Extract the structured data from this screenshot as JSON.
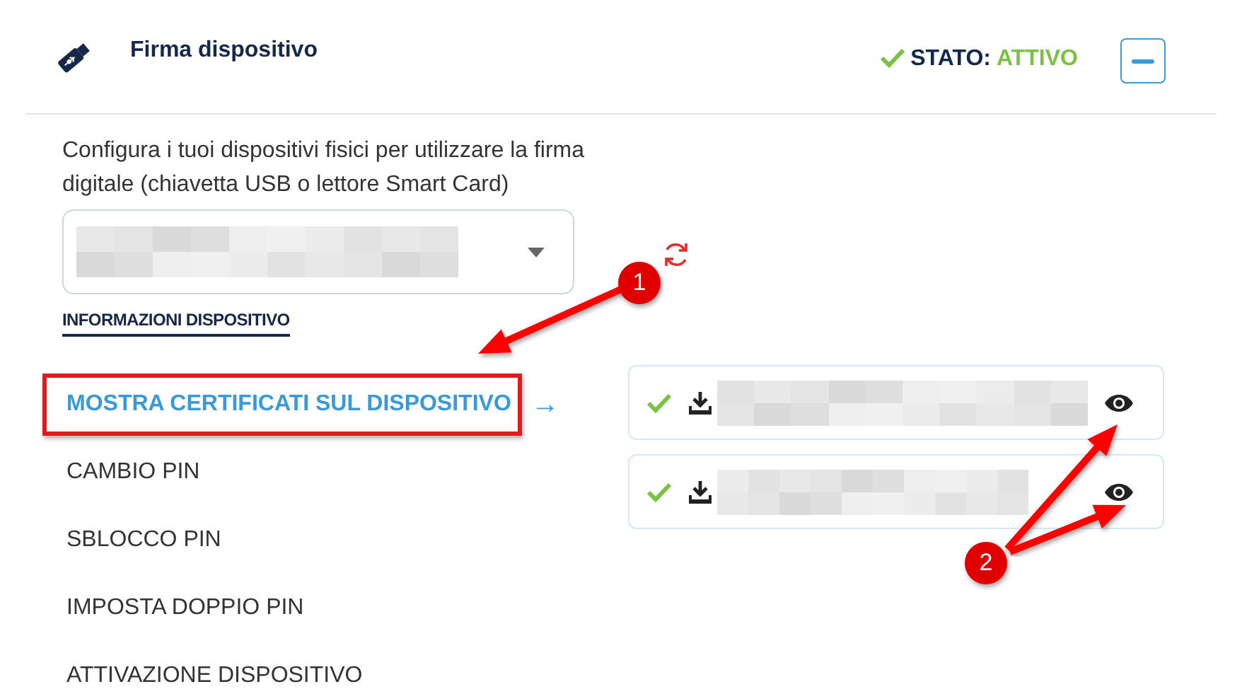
{
  "header": {
    "title": "Firma dispositivo",
    "status_label": "STATO:",
    "status_value": "ATTIVO",
    "active": true,
    "expanded": true
  },
  "description": "Configura i tuoi dispositivi fisici per utilizzare la firma digitale (chiavetta USB o lettore Smart Card)",
  "info_link": "INFORMAZIONI DISPOSITIVO",
  "menu": [
    {
      "label": "MOSTRA CERTIFICATI SUL DISPOSITIVO",
      "selected": true,
      "highlighted": true,
      "arrow": "→"
    },
    {
      "label": "CAMBIO PIN",
      "selected": false,
      "highlighted": false
    },
    {
      "label": "SBLOCCO PIN",
      "selected": false,
      "highlighted": false
    },
    {
      "label": "IMPOSTA DOPPIO PIN",
      "selected": false,
      "highlighted": false
    },
    {
      "label": "ATTIVAZIONE DISPOSITIVO",
      "selected": false,
      "highlighted": false
    }
  ],
  "certificates": [
    {
      "valid": true
    },
    {
      "valid": true
    }
  ],
  "annotations": [
    {
      "label": "1"
    },
    {
      "label": "2"
    }
  ]
}
